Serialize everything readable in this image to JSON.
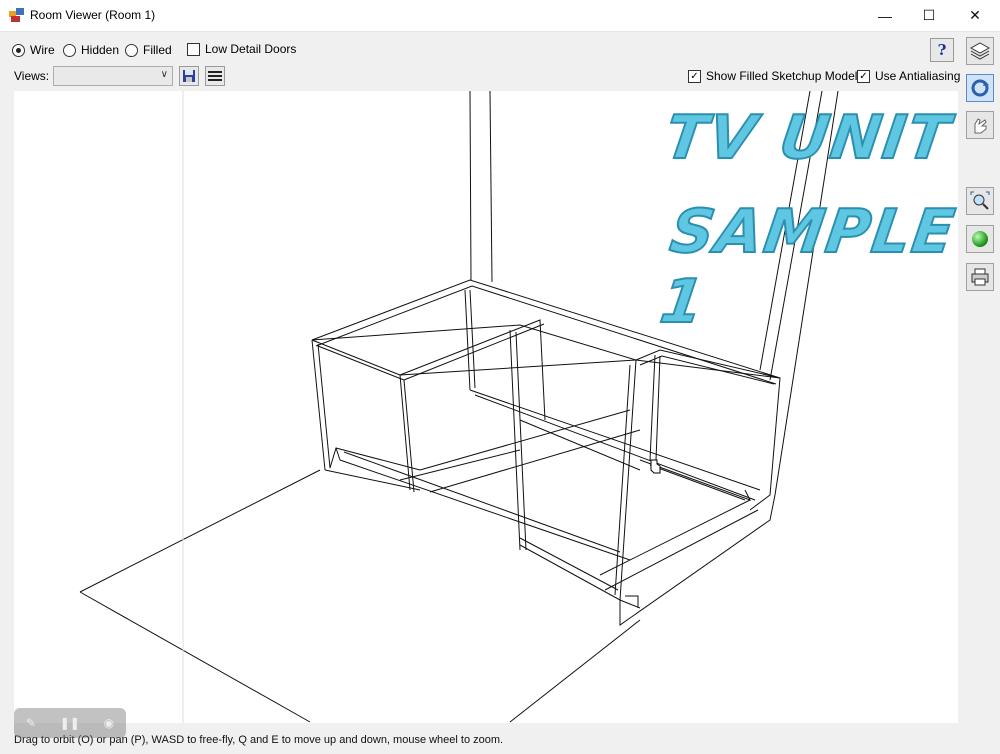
{
  "window": {
    "title": "Room Viewer (Room 1)",
    "minimize": "—",
    "maximize": "☐",
    "close": "✕"
  },
  "render_modes": {
    "options": [
      "Wire",
      "Hidden",
      "Filled"
    ],
    "selected": "Wire"
  },
  "low_detail_doors": {
    "label": "Low Detail Doors",
    "checked": false
  },
  "views": {
    "label": "Views:",
    "value": ""
  },
  "show_filled_sketchup": {
    "label": "Show Filled Sketchup Models",
    "checked": true
  },
  "use_antialiasing": {
    "label": "Use Antialiasing",
    "checked": true
  },
  "overlay_text": {
    "line1": "TV UNIT",
    "line2": "SAMPLE 1"
  },
  "status": {
    "text": "Drag to orbit (O) or pan (P), WASD to free-fly, Q and E to move up and down, mouse wheel to zoom."
  },
  "side_buttons": [
    "layers-icon",
    "orbit-icon",
    "pan-hand-icon",
    "zoom-extents-icon",
    "green-ball-icon",
    "print-icon"
  ],
  "colors": {
    "watermark": "#5fc7e2",
    "watermark_outline": "#2a8fb0"
  }
}
